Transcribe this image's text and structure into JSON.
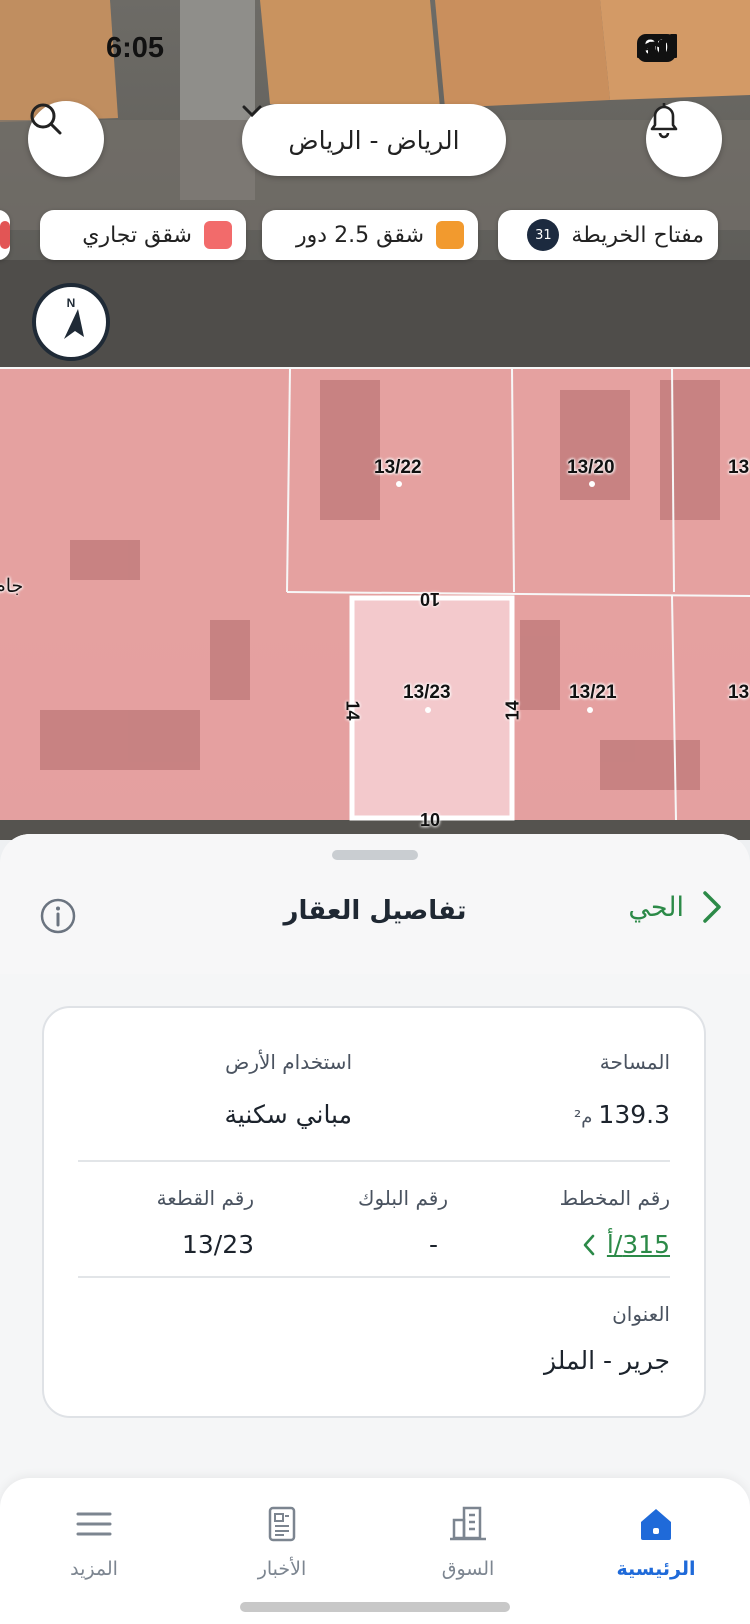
{
  "status": {
    "time": "6:05",
    "battery": "90"
  },
  "header": {
    "city": "الرياض - الرياض"
  },
  "chips": [
    {
      "label": "مفتاح الخريطة",
      "count": "31"
    },
    {
      "label": "شقق 2.5 دور",
      "color": "#f29a2e"
    },
    {
      "label": "شقق تجاري",
      "color": "#f26b6b"
    }
  ],
  "map": {
    "compass_letter": "N",
    "side_label": "جام",
    "plots": [
      "13/22",
      "13/20",
      "13/23",
      "13/21",
      "13",
      "13"
    ],
    "dimensions": [
      "10",
      "14",
      "14",
      "10"
    ],
    "colors": {
      "residential": "#f1a7a7",
      "selected": "#f3c9cc"
    }
  },
  "sheet": {
    "title": "تفاصيل العقار",
    "back_label": "الحي",
    "fields": {
      "area_label": "المساحة",
      "area_value": "139.3",
      "area_unit": "م²",
      "land_use_label": "استخدام الأرض",
      "land_use_value": "مباني سكنية",
      "plan_label": "رقم المخطط",
      "plan_value": "315/أ",
      "block_label": "رقم البلوك",
      "block_value": "-",
      "parcel_label": "رقم القطعة",
      "parcel_value": "13/23",
      "address_label": "العنوان",
      "address_value": "جرير - الملز"
    },
    "accent": "#2c8a48"
  },
  "tabs": [
    {
      "label": "الرئيسية",
      "active": true
    },
    {
      "label": "السوق"
    },
    {
      "label": "الأخبار"
    },
    {
      "label": "المزيد"
    }
  ]
}
